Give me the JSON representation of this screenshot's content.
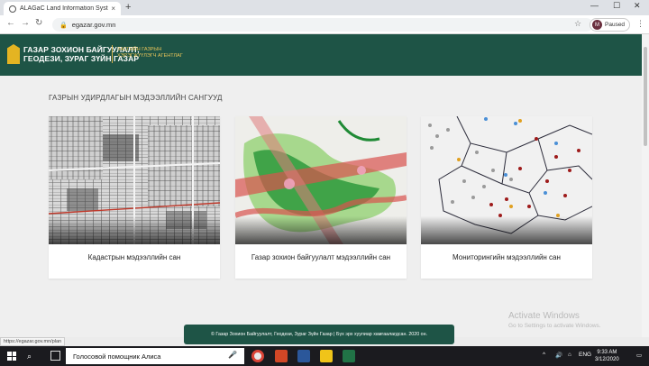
{
  "browser": {
    "tab_title": "ALAGaC Land Information Syste",
    "tab_close": "×",
    "new_tab": "+",
    "url": "egazar.gov.mn",
    "profile_initial": "M",
    "profile_status": "Paused",
    "status_url": "https://egazar.gov.mn/plan"
  },
  "header": {
    "org_line1": "ГАЗАР ЗОХИОН БАЙГУУЛАЛТ,",
    "org_line2": "ГЕОДЕЗИ, ЗУРАГ ЗҮЙН ГАЗАР",
    "agency_line1": "ЗАСГИЙН ГАЗРЫН",
    "agency_line2": "ХЭРЭГЖҮҮЛЭГЧ АГЕНТЛАГ",
    "logo_color": "#e4b422",
    "brand_color": "#1e5446"
  },
  "main": {
    "section_title": "ГАЗРЫН УДИРДЛАГЫН МЭДЭЭЛЛИЙН САНГУУД",
    "cards": [
      {
        "label": "Кадастрын мэдээллийн сан"
      },
      {
        "label": "Газар зохион байгуулалт мэдээллийн сан"
      },
      {
        "label": "Мониторингийн мэдээллийн сан"
      }
    ]
  },
  "footer": {
    "text": "© Газар Зохион Байгуулалт, Геодези, Зураг Зүйн Газар | Бүх эрх хуулиар хамгаалагдсан. 2020 он."
  },
  "watermark": {
    "title": "Activate Windows",
    "subtitle": "Go to Settings to activate Windows."
  },
  "taskbar": {
    "search_text": "Голосовой помощник Алиса",
    "lang": "ENG",
    "time": "9:33 AM",
    "date": "3/12/2020"
  }
}
